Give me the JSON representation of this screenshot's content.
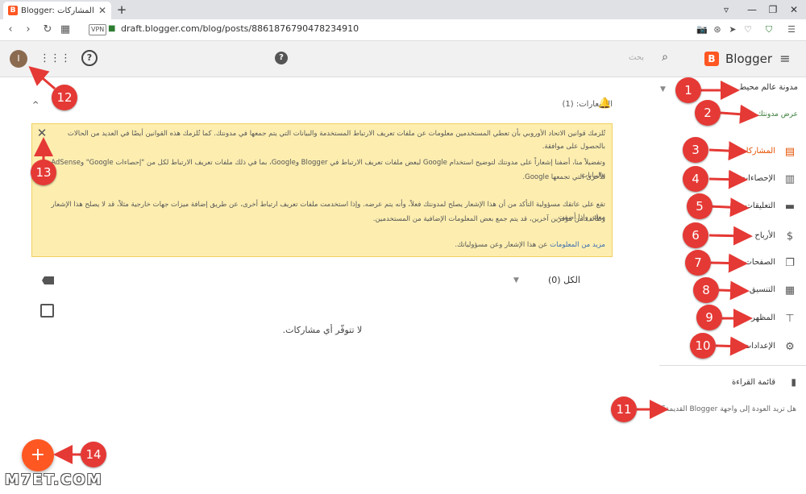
{
  "browser": {
    "tab_title": "Blogger: المشاركات",
    "tab_favicon": "B",
    "tab_close": "✕",
    "new_tab": "+",
    "vpn_label": "VPN",
    "url": "draft.blogger.com/blog/posts/8861876790478234910",
    "win_controls": [
      "▿",
      "—",
      "❐",
      "✕"
    ],
    "nav_icons": [
      "‹",
      "›",
      "↻",
      "▦"
    ],
    "right_icons": [
      "📷",
      "⊛",
      "➤",
      "♡",
      "⛉",
      "☰"
    ]
  },
  "topbar": {
    "avatar_letter": "I",
    "search_placeholder": "بحث",
    "brand_name": "Blogger",
    "logo_letter": "B",
    "help_glyph": "?",
    "question_glyph": "?",
    "menu_glyph": "≡",
    "apps_glyph": "⋮⋮⋮",
    "search_glyph": "⌕"
  },
  "main": {
    "collapse_glyph": "^",
    "notifications_header": "الإشعارات: (1)",
    "notice_lines": [
      "تُلزمك قوانين الاتحاد الأوروبي بأن تعطي المستخدمين معلومات عن ملفات تعريف الارتباط المستخدمة والبيانات التي يتم جمعها في مدونتك. كما تُلزمك هذه القوانين أيضًا في العديد من الحالات بالحصول على موافقة.",
      "وتفضيلاً منا، أضفنا إشعاراً على مدونتك لتوضيح استخدام Google لبعض ملفات تعريف الارتباط في Blogger وGoogle، بما في ذلك ملفات تعريف الارتباط لكل من \"إحصاءات Google\" وAdSense، والبيانات",
      "الأخرى التي تجمعها Google.",
      "تقع على عاتقك مسؤولية التأكد من أن هذا الإشعار يصلح لمدونتك فعلاً، وأنه يتم عرضه. وإذا استخدمت ملفات تعريف ارتباط أخرى، عن طريق إضافة ميزات جهات خارجية مثلاً، قد لا يصلح هذا الإشعار معك. وإذا أضفت",
      "وظائف من موفرين آخرين، قد يتم جمع بعض المعلومات الإضافية من المستخدمين."
    ],
    "notice_link": "مزيد من المعلومات",
    "notice_tail": "عن هذا الإشعار وعن مسؤولياتك.",
    "close_glyph": "✕",
    "filter_label": "الكل (0)",
    "filter_arrow": "▼",
    "empty_message": "لا تتوفّر أي مشاركات."
  },
  "sidebar": {
    "blog_name": "مدونة عالم محيط",
    "blog_arrow": "▼",
    "view_blog": "عرض مدونتك",
    "items": [
      {
        "label": "المشاركات",
        "icon": "▤",
        "active": true
      },
      {
        "label": "الإحصاءات",
        "icon": "▥",
        "active": false
      },
      {
        "label": "التعليقات",
        "icon": "▬",
        "active": false
      },
      {
        "label": "الأرباح",
        "icon": "$",
        "active": false
      },
      {
        "label": "الصفحات",
        "icon": "❐",
        "active": false
      },
      {
        "label": "التنسيق",
        "icon": "▦",
        "active": false
      },
      {
        "label": "المظهر",
        "icon": "⊤",
        "active": false
      },
      {
        "label": "الإعدادات",
        "icon": "⚙",
        "active": false
      }
    ],
    "reading_list": "قائمة القراءة",
    "reading_icon": "▮",
    "old_blogger": "هل تريد العودة إلى واجهة Blogger القديمة؟"
  },
  "fab_glyph": "+",
  "watermark": "M7ET.COM",
  "annotations": [
    "1",
    "2",
    "3",
    "4",
    "5",
    "6",
    "7",
    "8",
    "9",
    "10",
    "11",
    "12",
    "13",
    "14"
  ],
  "colors": {
    "accent": "#ff5722",
    "badge": "#e53935",
    "notice_bg": "#fdeeb0"
  }
}
